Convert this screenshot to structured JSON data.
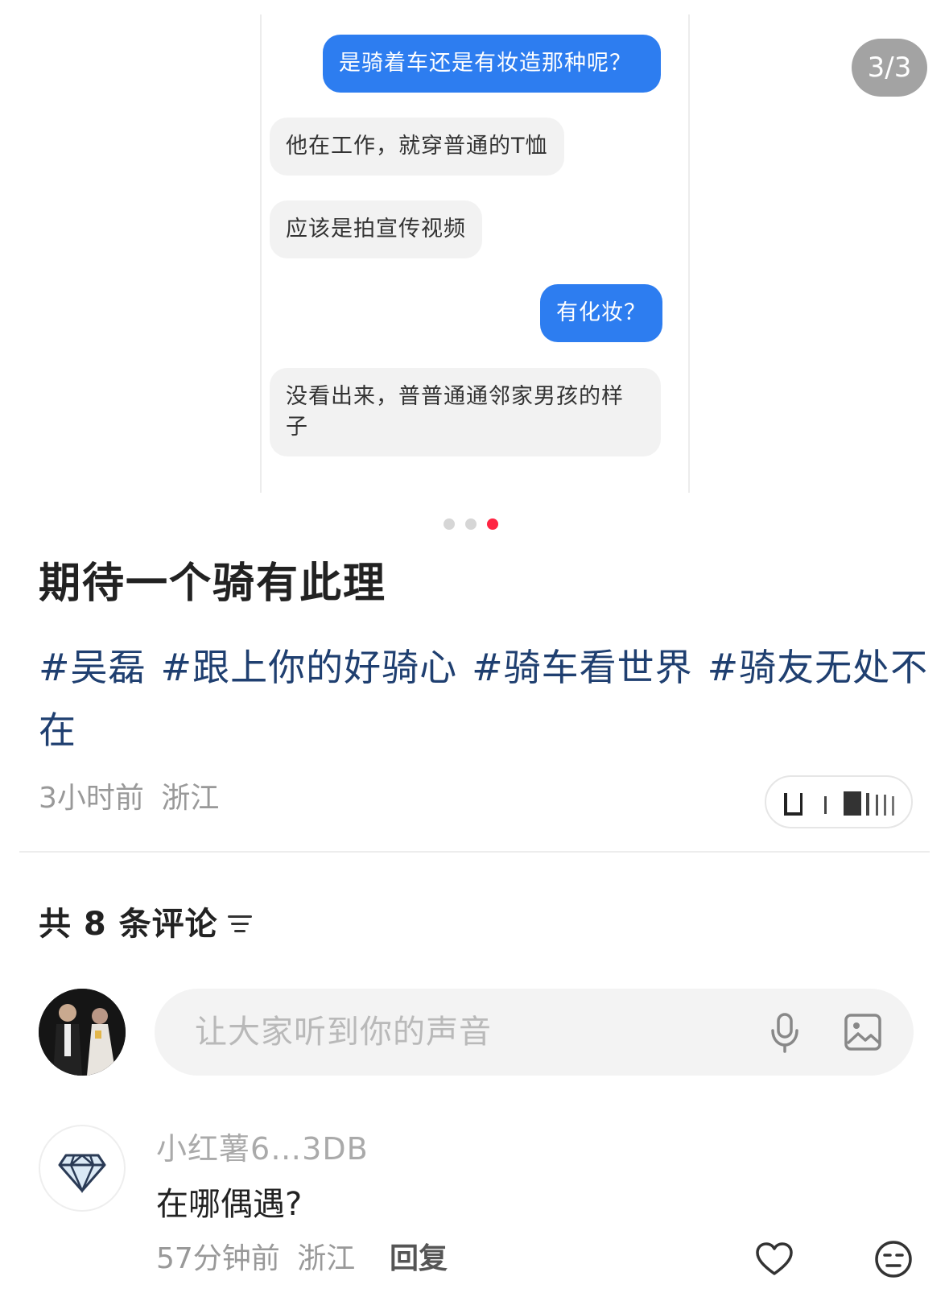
{
  "gallery": {
    "counter": "3/3",
    "current": 3,
    "total": 3,
    "chat": [
      {
        "side": "out",
        "text": "是骑着车还是有妆造那种呢？"
      },
      {
        "side": "in",
        "text": "他在工作，就穿普通的T恤"
      },
      {
        "side": "in",
        "text": "应该是拍宣传视频"
      },
      {
        "side": "out",
        "text": "有化妆？"
      },
      {
        "side": "in",
        "text": "没看出来，普普通通邻家男孩的样子"
      }
    ]
  },
  "post": {
    "title": "期待一个骑有此理",
    "hashtags": [
      "#吴磊",
      "#跟上你的好骑心",
      "#骑车看世界",
      "#骑友无处不在"
    ],
    "time": "3小时前",
    "location": "浙江"
  },
  "comments": {
    "header": "共 8 条评论",
    "input_placeholder": "让大家听到你的声音",
    "items": [
      {
        "user": "小红薯6…3DB",
        "text": "在哪偶遇?",
        "time": "57分钟前",
        "location": "浙江",
        "reply_label": "回复"
      }
    ]
  },
  "icons": {
    "sort": "sort-icon",
    "mic": "microphone-icon",
    "image": "image-icon",
    "like": "heart-icon",
    "emoji": "emoji-icon",
    "avatar_badge": "diamond-icon"
  },
  "colors": {
    "accent_red": "#ff2442",
    "chat_blue": "#2d7df0",
    "hashtag": "#1f3f70"
  }
}
